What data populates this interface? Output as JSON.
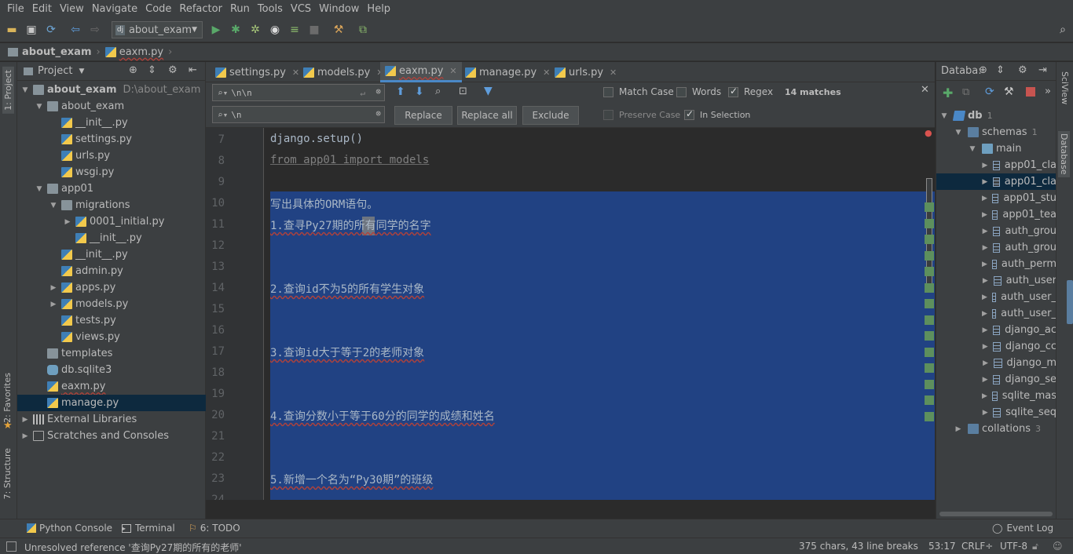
{
  "menu": [
    "File",
    "Edit",
    "View",
    "Navigate",
    "Code",
    "Refactor",
    "Run",
    "Tools",
    "VCS",
    "Window",
    "Help"
  ],
  "toolbar": {
    "run_config": "about_exam"
  },
  "breadcrumb": {
    "project": "about_exam",
    "file": "eaxm.py"
  },
  "left_stripe": {
    "project": "1: Project",
    "favorites": "2: Favorites",
    "structure": "7: Structure"
  },
  "project": {
    "header": "Project",
    "tree": [
      {
        "label": "about_exam",
        "suffix": "D:\\about_exam",
        "depth": 0,
        "arrow": "▼",
        "icon": "folder",
        "bold": true
      },
      {
        "label": "about_exam",
        "depth": 1,
        "arrow": "▼",
        "icon": "folder"
      },
      {
        "label": "__init__.py",
        "depth": 2,
        "arrow": "",
        "icon": "py"
      },
      {
        "label": "settings.py",
        "depth": 2,
        "arrow": "",
        "icon": "py"
      },
      {
        "label": "urls.py",
        "depth": 2,
        "arrow": "",
        "icon": "py"
      },
      {
        "label": "wsgi.py",
        "depth": 2,
        "arrow": "",
        "icon": "py"
      },
      {
        "label": "app01",
        "depth": 1,
        "arrow": "▼",
        "icon": "folder"
      },
      {
        "label": "migrations",
        "depth": 2,
        "arrow": "▼",
        "icon": "folder"
      },
      {
        "label": "0001_initial.py",
        "depth": 3,
        "arrow": "▶",
        "icon": "py"
      },
      {
        "label": "__init__.py",
        "depth": 3,
        "arrow": "",
        "icon": "py"
      },
      {
        "label": "__init__.py",
        "depth": 2,
        "arrow": "",
        "icon": "py"
      },
      {
        "label": "admin.py",
        "depth": 2,
        "arrow": "",
        "icon": "py"
      },
      {
        "label": "apps.py",
        "depth": 2,
        "arrow": "▶",
        "icon": "py"
      },
      {
        "label": "models.py",
        "depth": 2,
        "arrow": "▶",
        "icon": "py"
      },
      {
        "label": "tests.py",
        "depth": 2,
        "arrow": "",
        "icon": "py"
      },
      {
        "label": "views.py",
        "depth": 2,
        "arrow": "",
        "icon": "py"
      },
      {
        "label": "templates",
        "depth": 1,
        "arrow": "",
        "icon": "folder"
      },
      {
        "label": "db.sqlite3",
        "depth": 1,
        "arrow": "",
        "icon": "db"
      },
      {
        "label": "eaxm.py",
        "depth": 1,
        "arrow": "",
        "icon": "py"
      },
      {
        "label": "manage.py",
        "depth": 1,
        "arrow": "",
        "icon": "py",
        "selected": true
      },
      {
        "label": "External Libraries",
        "depth": 0,
        "arrow": "▶",
        "icon": "lib"
      },
      {
        "label": "Scratches and Consoles",
        "depth": 0,
        "arrow": "▶",
        "icon": "scratch"
      }
    ]
  },
  "tabs": [
    {
      "label": "settings.py"
    },
    {
      "label": "models.py"
    },
    {
      "label": "eaxm.py",
      "active": true
    },
    {
      "label": "manage.py"
    },
    {
      "label": "urls.py"
    }
  ],
  "find": {
    "search_value": "\\n\\n",
    "replace_value": "\\n",
    "match_case": "Match Case",
    "words": "Words",
    "regex": "Regex",
    "matches": "14 matches",
    "preserve_case": "Preserve Case",
    "in_selection": "In Selection",
    "replace_btn": "Replace",
    "replace_all_btn": "Replace all",
    "exclude_btn": "Exclude"
  },
  "editor": {
    "line_numbers": [
      "7",
      "8",
      "9",
      "10",
      "11",
      "12",
      "13",
      "14",
      "15",
      "16",
      "17",
      "18",
      "19",
      "20",
      "21",
      "22",
      "23",
      "24"
    ],
    "lines": [
      {
        "text": "django.setup()",
        "style": "plain"
      },
      {
        "text": "from app01 import models",
        "style": "unused"
      },
      {
        "text": "",
        "style": "plain"
      },
      {
        "text": "写出具体的ORM语句。",
        "style": "plain"
      },
      {
        "text": "1.查寻Py27期的所有同学的名字",
        "style": "squig"
      },
      {
        "text": "",
        "style": "plain"
      },
      {
        "text": "",
        "style": "plain"
      },
      {
        "text": "2.查询id不为5的所有学生对象",
        "style": "squig"
      },
      {
        "text": "",
        "style": "plain"
      },
      {
        "text": "",
        "style": "plain"
      },
      {
        "text": "3.查询id大于等于2的老师对象",
        "style": "squig"
      },
      {
        "text": "",
        "style": "plain"
      },
      {
        "text": "",
        "style": "plain"
      },
      {
        "text": "4.查询分数小于等于60分的同学的成绩和姓名",
        "style": "squig"
      },
      {
        "text": "",
        "style": "plain"
      },
      {
        "text": "",
        "style": "plain"
      },
      {
        "text": "5.新增一个名为“Py30期”的班级",
        "style": "squig"
      }
    ]
  },
  "database": {
    "header": "Databa:",
    "tree": [
      {
        "label": "db",
        "count": "1",
        "depth": 0,
        "arrow": "▼",
        "icon": "db"
      },
      {
        "label": "schemas",
        "count": "1",
        "depth": 1,
        "arrow": "▼",
        "icon": "folder"
      },
      {
        "label": "main",
        "count": "",
        "depth": 2,
        "arrow": "▼",
        "icon": "schema"
      },
      {
        "label": "app01_cla",
        "depth": 3,
        "arrow": "▶",
        "icon": "table"
      },
      {
        "label": "app01_cla",
        "depth": 3,
        "arrow": "▶",
        "icon": "table",
        "selected": true
      },
      {
        "label": "app01_stu",
        "depth": 3,
        "arrow": "▶",
        "icon": "table"
      },
      {
        "label": "app01_tea",
        "depth": 3,
        "arrow": "▶",
        "icon": "table"
      },
      {
        "label": "auth_grou",
        "depth": 3,
        "arrow": "▶",
        "icon": "table"
      },
      {
        "label": "auth_grou",
        "depth": 3,
        "arrow": "▶",
        "icon": "table"
      },
      {
        "label": "auth_perm",
        "depth": 3,
        "arrow": "▶",
        "icon": "table"
      },
      {
        "label": "auth_user",
        "depth": 3,
        "arrow": "▶",
        "icon": "table"
      },
      {
        "label": "auth_user_",
        "depth": 3,
        "arrow": "▶",
        "icon": "table"
      },
      {
        "label": "auth_user_",
        "depth": 3,
        "arrow": "▶",
        "icon": "table"
      },
      {
        "label": "django_ac",
        "depth": 3,
        "arrow": "▶",
        "icon": "table"
      },
      {
        "label": "django_cc",
        "depth": 3,
        "arrow": "▶",
        "icon": "table"
      },
      {
        "label": "django_m",
        "depth": 3,
        "arrow": "▶",
        "icon": "table"
      },
      {
        "label": "django_se",
        "depth": 3,
        "arrow": "▶",
        "icon": "table"
      },
      {
        "label": "sqlite_mas",
        "depth": 3,
        "arrow": "▶",
        "icon": "table"
      },
      {
        "label": "sqlite_seq",
        "depth": 3,
        "arrow": "▶",
        "icon": "table"
      },
      {
        "label": "collations",
        "count": "3",
        "depth": 1,
        "arrow": "▶",
        "icon": "folder"
      }
    ]
  },
  "right_stripe": {
    "sciview": "SciView",
    "database": "Database"
  },
  "bottom_tabs": {
    "python_console": "Python Console",
    "terminal": "Terminal",
    "todo": "6: TODO",
    "event_log": "Event Log"
  },
  "status": {
    "message": "Unresolved reference '查询Py27期的所有的老师'",
    "chars": "375 chars, 43 line breaks",
    "position": "53:17",
    "line_sep": "CRLF÷",
    "encoding": "UTF-8"
  },
  "colors": {
    "accent": "#4a88c7",
    "selection": "#214283",
    "tree_selection": "#0d293e",
    "run_green": "#59a869",
    "stop_red": "#c75450"
  }
}
